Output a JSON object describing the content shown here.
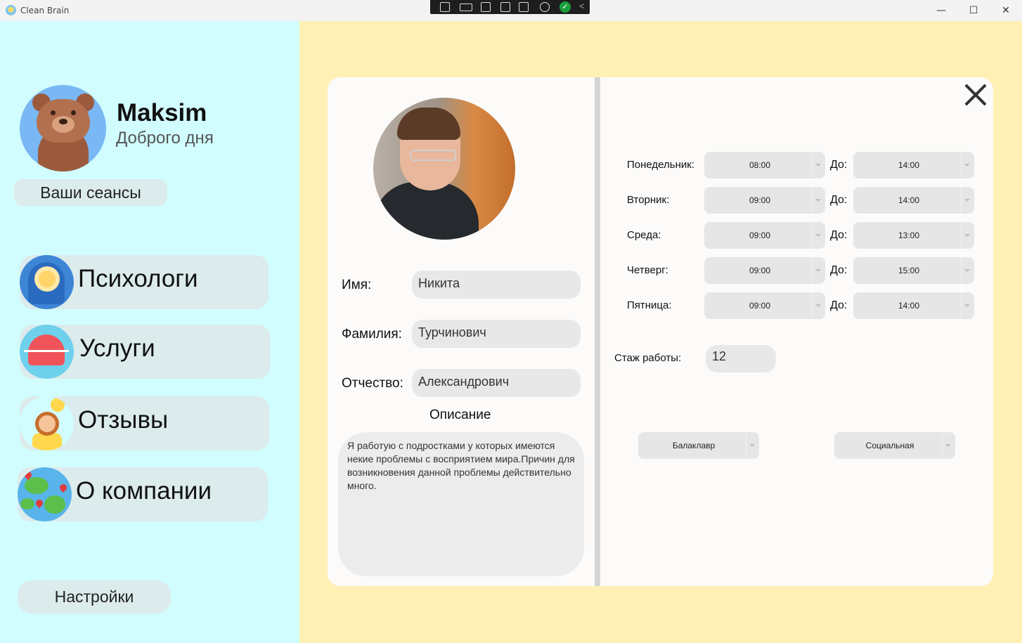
{
  "window": {
    "title": "Clean Brain",
    "minimize_glyph": "—",
    "maximize_glyph": "☐",
    "close_glyph": "✕"
  },
  "debug_toolbar": {
    "ok_glyph": "✓",
    "collapse_glyph": "<"
  },
  "user": {
    "name": "Maksim",
    "greeting": "Доброго дня"
  },
  "sidebar": {
    "sessions_label": "Ваши сеансы",
    "items": [
      {
        "label": "Психологи",
        "icon": "brain-head-icon"
      },
      {
        "label": "Услуги",
        "icon": "heart-pulse-icon"
      },
      {
        "label": "Отзывы",
        "icon": "happy-person-icon"
      },
      {
        "label": "О компании",
        "icon": "globe-icon"
      }
    ],
    "settings_label": "Настройки"
  },
  "profile": {
    "first_name_label": "Имя:",
    "first_name": "Никита",
    "last_name_label": "Фамилия:",
    "last_name": "Турчинович",
    "patronymic_label": "Отчество:",
    "patronymic": "Александрович",
    "description_title": "Описание",
    "description": "Я работую с подростками у которых имеются некие проблемы с восприятием мира.Причин для возникновения данной проблемы действительно много."
  },
  "schedule": {
    "to_label": "До:",
    "days": [
      {
        "label": "Понедельник:",
        "from": "08:00",
        "to": "14:00"
      },
      {
        "label": "Вторник:",
        "from": "09:00",
        "to": "14:00"
      },
      {
        "label": "Среда:",
        "from": "09:00",
        "to": "13:00"
      },
      {
        "label": "Четверг:",
        "from": "09:00",
        "to": "15:00"
      },
      {
        "label": "Пятница:",
        "from": "09:00",
        "to": "14:00"
      }
    ]
  },
  "experience": {
    "label": "Стаж работы:",
    "value": "12"
  },
  "education": {
    "degree": "Балаклавр",
    "specialization": "Социальная"
  },
  "colors": {
    "sidebar_bg": "#d1fdff",
    "main_bg": "#fff0b6",
    "card_bg": "#fcfbfa",
    "button_bg": "#dcebec",
    "field_bg": "#e8e8e8"
  }
}
